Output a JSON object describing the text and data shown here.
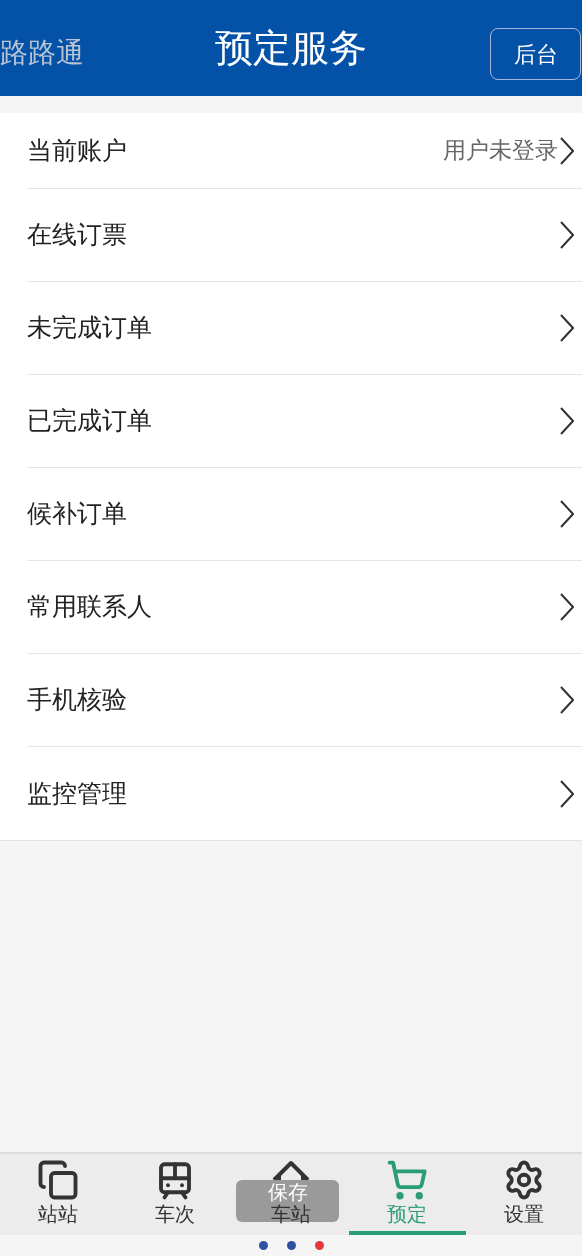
{
  "header": {
    "brand": "路路通",
    "title": "预定服务",
    "action": "后台"
  },
  "menu": [
    {
      "label": "当前账户",
      "value": "用户未登录"
    },
    {
      "label": "在线订票"
    },
    {
      "label": "未完成订单"
    },
    {
      "label": "已完成订单"
    },
    {
      "label": "候补订单"
    },
    {
      "label": "常用联系人"
    },
    {
      "label": "手机核验"
    },
    {
      "label": "监控管理"
    }
  ],
  "tabs": [
    {
      "label": "站站",
      "selected": false
    },
    {
      "label": "车次",
      "selected": false
    },
    {
      "label": "车站",
      "selected": false
    },
    {
      "label": "预定",
      "selected": true
    },
    {
      "label": "设置",
      "selected": false
    }
  ],
  "toast": "保存",
  "page_dots": [
    {
      "color": "#3050a0"
    },
    {
      "color": "#3050a0"
    },
    {
      "color": "#e8383d"
    }
  ]
}
